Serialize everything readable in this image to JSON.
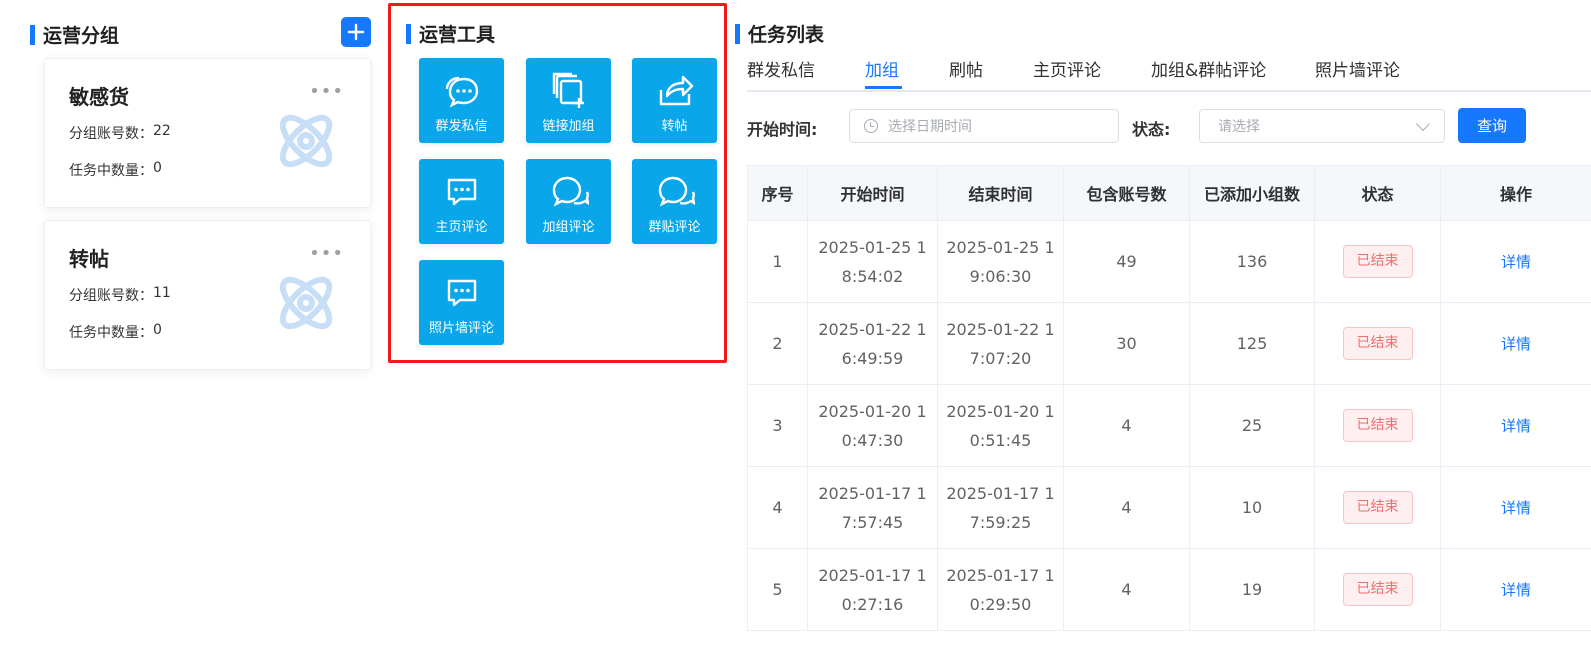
{
  "groups": {
    "title": "运营分组",
    "items": [
      {
        "name": "敏感货",
        "account_label": "分组账号数：",
        "account_count": "22",
        "task_label": "任务中数量：",
        "task_count": "0"
      },
      {
        "name": "转帖",
        "account_label": "分组账号数：",
        "account_count": "11",
        "task_label": "任务中数量：",
        "task_count": "0"
      }
    ],
    "more": "•••",
    "add_icon": "plus-icon"
  },
  "tools": {
    "title": "运营工具",
    "items": [
      {
        "label": "群发私信",
        "icon": "chat-bubbles-icon"
      },
      {
        "label": "链接加组",
        "icon": "copy-add-icon"
      },
      {
        "label": "转帖",
        "icon": "share-icon"
      },
      {
        "label": "主页评论",
        "icon": "comment-icon"
      },
      {
        "label": "加组评论",
        "icon": "chat-icon"
      },
      {
        "label": "群贴评论",
        "icon": "chat-icon"
      },
      {
        "label": "照片墙评论",
        "icon": "comment-icon"
      }
    ],
    "tile_color": "#0aa6ea"
  },
  "tasks": {
    "title": "任务列表",
    "tabs": [
      "群发私信",
      "加组",
      "刷帖",
      "主页评论",
      "加组&群帖评论",
      "照片墙评论"
    ],
    "active_tab": "加组",
    "filter": {
      "start_label": "开始时间:",
      "date_placeholder": "选择日期时间",
      "status_label": "状态:",
      "status_placeholder": "请选择",
      "query_label": "查询"
    },
    "columns": [
      "序号",
      "开始时间",
      "结束时间",
      "包含账号数",
      "已添加小组数",
      "状态",
      "操作"
    ],
    "rows": [
      {
        "no": "1",
        "start": "2025-01-25 18:54:02",
        "end": "2025-01-25 19:06:30",
        "accounts": "49",
        "groups": "136",
        "status": "已结束",
        "action": "详情"
      },
      {
        "no": "2",
        "start": "2025-01-22 16:49:59",
        "end": "2025-01-22 17:07:20",
        "accounts": "30",
        "groups": "125",
        "status": "已结束",
        "action": "详情"
      },
      {
        "no": "3",
        "start": "2025-01-20 10:47:30",
        "end": "2025-01-20 10:51:45",
        "accounts": "4",
        "groups": "25",
        "status": "已结束",
        "action": "详情"
      },
      {
        "no": "4",
        "start": "2025-01-17 17:57:45",
        "end": "2025-01-17 17:59:25",
        "accounts": "4",
        "groups": "10",
        "status": "已结束",
        "action": "详情"
      },
      {
        "no": "5",
        "start": "2025-01-17 10:27:16",
        "end": "2025-01-17 10:29:50",
        "accounts": "4",
        "groups": "19",
        "status": "已结束",
        "action": "详情"
      }
    ]
  },
  "colors": {
    "accent": "#1677ff",
    "highlight_border": "#ee1c1c",
    "status_text": "#f56c6c"
  }
}
